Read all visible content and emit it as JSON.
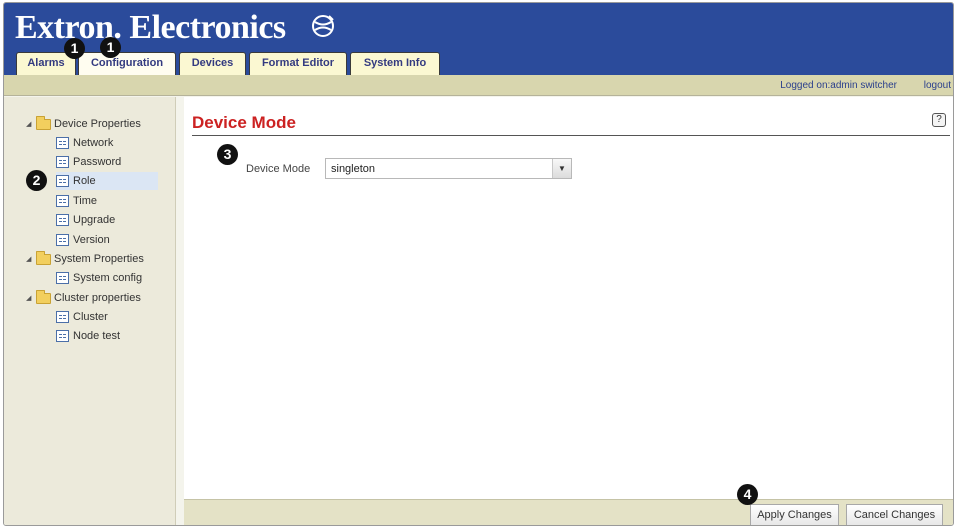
{
  "brand": {
    "title": "Extron. Electronics"
  },
  "tabs": [
    "Alarms",
    "Configuration",
    "Devices",
    "Format Editor",
    "System Info"
  ],
  "status": {
    "login": "Logged on:admin  switcher",
    "logout": "logout"
  },
  "sidebar": {
    "groups": [
      {
        "label": "Device Properties",
        "items": [
          "Network",
          "Password",
          "Role",
          "Time",
          "Upgrade",
          "Version"
        ]
      },
      {
        "label": "System Properties",
        "items": [
          "System config"
        ]
      },
      {
        "label": "Cluster properties",
        "items": [
          "Cluster",
          "Node test"
        ]
      }
    ],
    "selected": "Role"
  },
  "main": {
    "title": "Device Mode",
    "help": "?",
    "field_label": "Device Mode",
    "field_value": "singleton"
  },
  "footer": {
    "apply": "Apply Changes",
    "cancel": "Cancel Changes"
  },
  "callouts": [
    "1",
    "1",
    "2",
    "3",
    "4"
  ],
  "colors": {
    "header": "#2b4b9b",
    "title": "#cc2222",
    "tab": "#fbf8d2",
    "statusbar": "#d8d6ae"
  }
}
